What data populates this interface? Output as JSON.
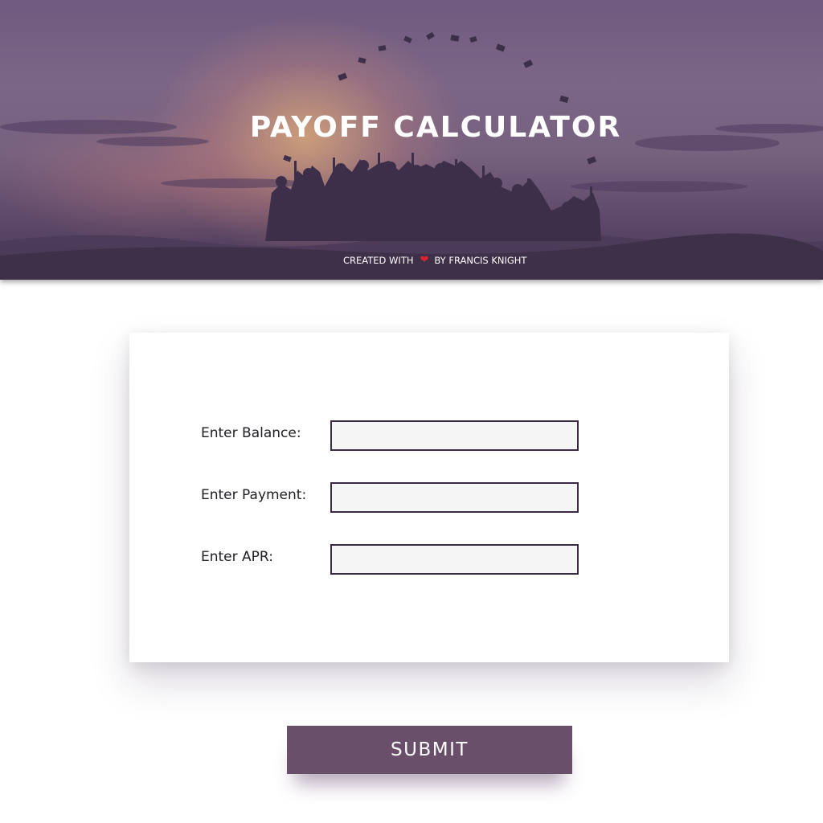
{
  "header": {
    "title": "PAYOFF CALCULATOR",
    "credit_prefix": "CREATED WITH",
    "credit_icon": "heart-icon",
    "credit_suffix": "BY FRANCIS KNIGHT"
  },
  "form": {
    "balance": {
      "label": "Enter Balance:",
      "value": "",
      "placeholder": ""
    },
    "payment": {
      "label": "Enter Payment:",
      "value": "",
      "placeholder": ""
    },
    "apr": {
      "label": "Enter APR:",
      "value": "",
      "placeholder": ""
    }
  },
  "actions": {
    "submit_label": "SUBMIT"
  },
  "colors": {
    "hero_overlay": "#6f5b7f",
    "button": "#6a4f6b",
    "input_border": "#3a2a46",
    "input_bg": "#f5f5f5",
    "heart": "#e0242f"
  }
}
